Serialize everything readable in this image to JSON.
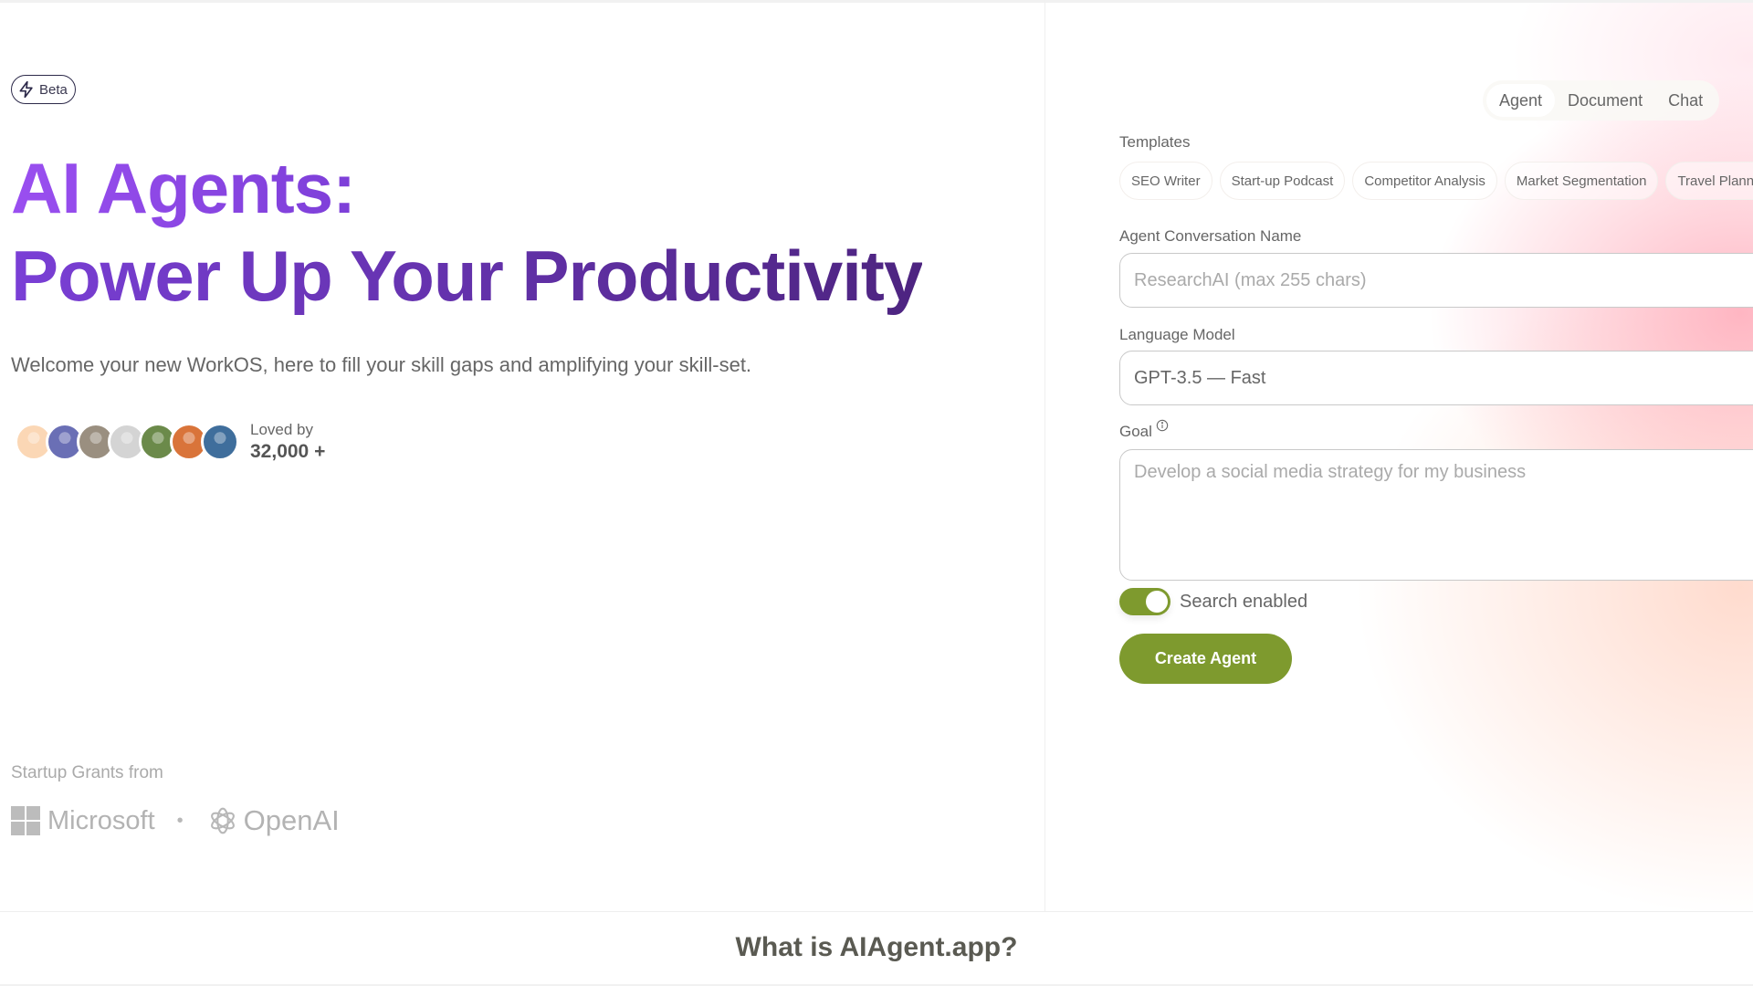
{
  "hero": {
    "badge": {
      "icon": "lightning-icon",
      "label": "Beta"
    },
    "headline_line1": "AI Agents:",
    "headline_line2": "Power Up Your Productivity",
    "subtitle": "Welcome your new WorkOS, here to fill your skill gaps and amplifying your skill-set.",
    "social_proof": {
      "label": "Loved by",
      "count": "32,000 +",
      "avatars": [
        {
          "name": "avatar-1",
          "color": "#fbd7b5"
        },
        {
          "name": "avatar-2",
          "color": "#6a6fb5"
        },
        {
          "name": "avatar-3",
          "color": "#9a8f80"
        },
        {
          "name": "avatar-4",
          "color": "#d4d4d4"
        },
        {
          "name": "avatar-5",
          "color": "#6b8a4a"
        },
        {
          "name": "avatar-6",
          "color": "#d9743a"
        },
        {
          "name": "avatar-7",
          "color": "#3f6e9c"
        }
      ]
    },
    "grants": {
      "label": "Startup Grants from",
      "partners": [
        "Microsoft",
        "OpenAI"
      ],
      "separator": "•"
    }
  },
  "panel": {
    "tabs": [
      {
        "label": "Agent",
        "active": true
      },
      {
        "label": "Document",
        "active": false
      },
      {
        "label": "Chat",
        "active": false
      }
    ],
    "templates_label": "Templates",
    "templates": [
      "SEO Writer",
      "Start-up Podcast",
      "Competitor Analysis",
      "Market Segmentation",
      "Travel Planner"
    ],
    "name_field": {
      "label": "Agent Conversation Name",
      "placeholder": "ResearchAI (max 255 chars)",
      "value": ""
    },
    "model_field": {
      "label": "Language Model",
      "value": "GPT-3.5 — Fast"
    },
    "goal_field": {
      "label": "Goal",
      "info_icon": "info-icon",
      "placeholder": "Develop a social media strategy for my business",
      "value": ""
    },
    "search_toggle": {
      "label": "Search enabled",
      "on": true
    },
    "create_button": "Create Agent"
  },
  "bottom": {
    "title": "What is AIAgent.app?"
  },
  "colors": {
    "accent_green": "#7e9a2e",
    "headline_purple_start": "#9a4ff0",
    "headline_purple_end": "#4d2480"
  }
}
